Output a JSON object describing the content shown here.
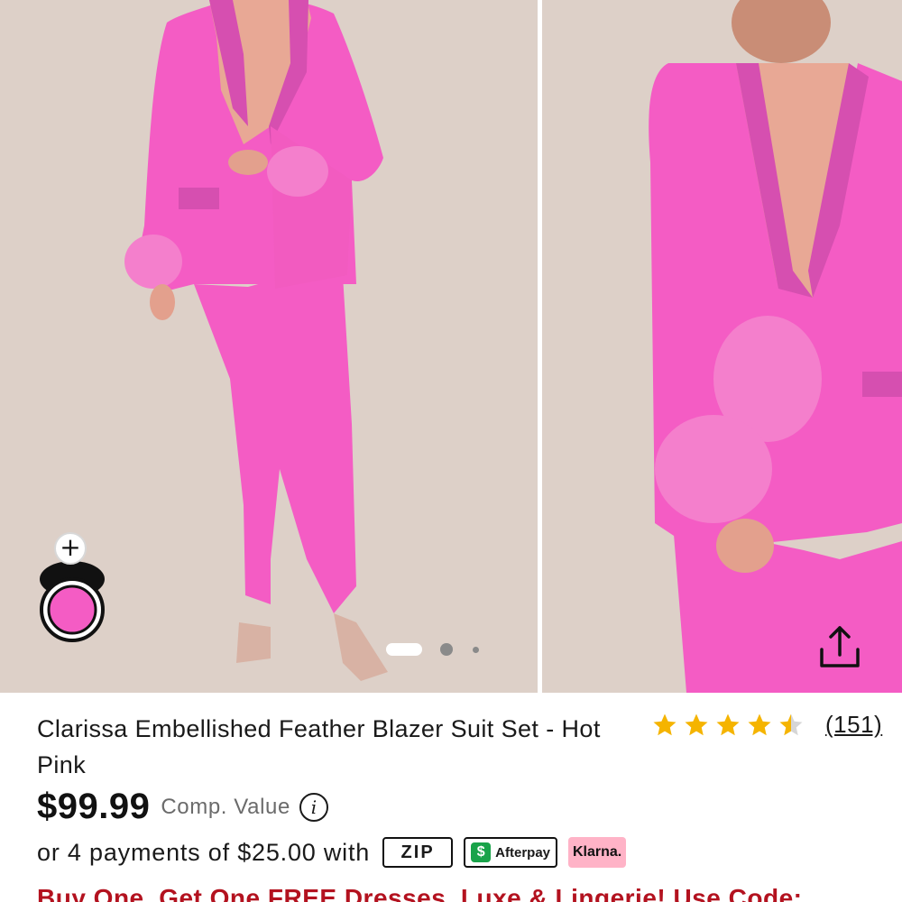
{
  "product": {
    "title": "Clarissa Embellished Feather Blazer Suit Set - Hot Pink",
    "price": "$99.99",
    "comp_value_label": "Comp. Value",
    "rating": 4.5,
    "review_count": "(151)",
    "payments_text": "or 4 payments of $25.00 with",
    "promo": "Buy One, Get One FREE Dresses, Luxe & Lingerie! Use Code:"
  },
  "payment_providers": {
    "zip": "ZIP",
    "afterpay": "Afterpay",
    "klarna": "Klarna."
  },
  "gallery": {
    "image_count": 3,
    "active_index": 0
  },
  "icons": {
    "add": "plus-icon",
    "share": "share-icon",
    "info": "info-icon",
    "star": "star-icon"
  },
  "colors": {
    "star": "#f5b400",
    "star_empty": "#d6d6d6",
    "promo": "#b3121f",
    "suit_pink": "#f23fb5",
    "background_beige": "#ddd0c8",
    "afterpay_green": "#19a34a",
    "klarna_pink": "#ffb3c7"
  }
}
